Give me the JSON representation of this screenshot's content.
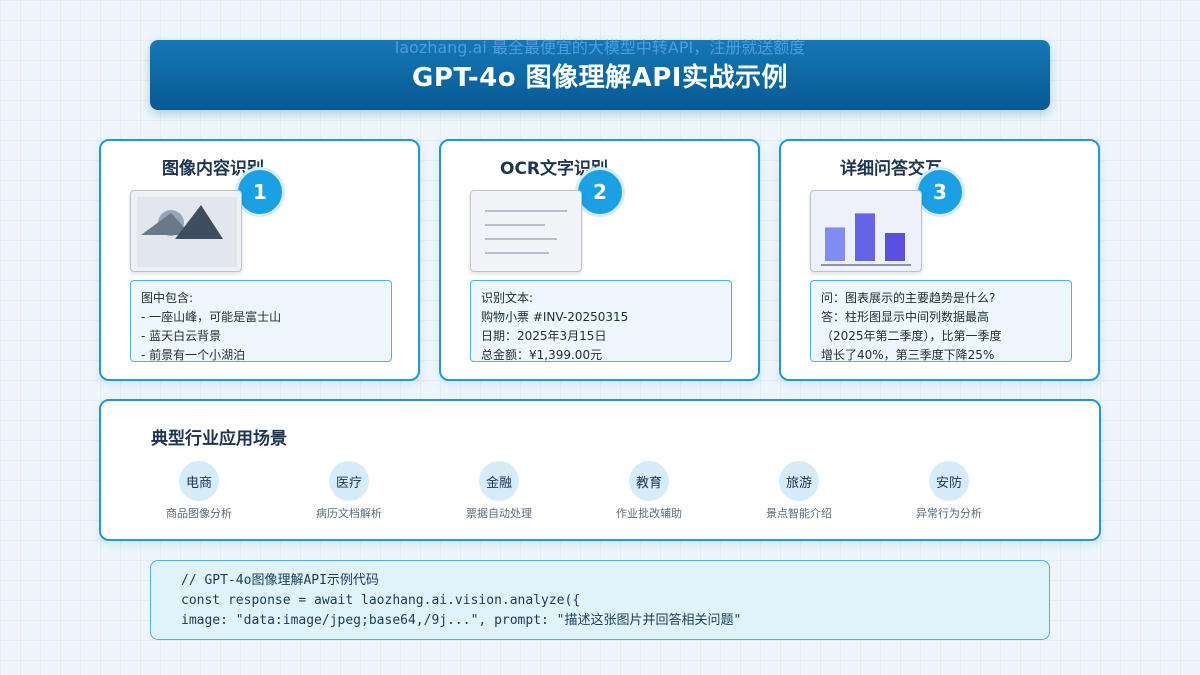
{
  "watermark": "laozhang.ai 最全最便宜的大模型中转API，注册就送额度",
  "title": "GPT-4o 图像理解API实战示例",
  "cards": [
    {
      "title": "图像内容识别",
      "number": "1",
      "lines": [
        "图中包含:",
        "- 一座山峰，可能是富士山",
        "- 蓝天白云背景",
        "- 前景有一个小湖泊"
      ]
    },
    {
      "title": "OCR文字识别",
      "number": "2",
      "lines": [
        "识别文本:",
        "购物小票 #INV-20250315",
        "日期：2025年3月15日",
        "总金额：¥1,399.00元"
      ]
    },
    {
      "title": "详细问答交互",
      "number": "3",
      "lines": [
        "问：图表展示的主要趋势是什么?",
        "答：柱形图显示中间列数据最高",
        "（2025年第二季度），比第一季度",
        "增长了40%，第三季度下降25%"
      ]
    }
  ],
  "industries": {
    "title": "典型行业应用场景",
    "items": [
      {
        "name": "电商",
        "desc": "商品图像分析"
      },
      {
        "name": "医疗",
        "desc": "病历文档解析"
      },
      {
        "name": "金融",
        "desc": "票据自动处理"
      },
      {
        "name": "教育",
        "desc": "作业批改辅助"
      },
      {
        "name": "旅游",
        "desc": "景点智能介绍"
      },
      {
        "name": "安防",
        "desc": "异常行为分析"
      }
    ]
  },
  "code": {
    "lines": [
      "// GPT-4o图像理解API示例代码",
      "const response = await laozhang.ai.vision.analyze({",
      "image: \"data:image/jpeg;base64,/9j...\", prompt: \"描述这张图片并回答相关问题\""
    ]
  },
  "colors": {
    "accent": "#1aa0e4",
    "border": "#1d9ad6",
    "title_bar": "#075a92",
    "bar_chart": [
      "#7f8cf0",
      "#6663e6",
      "#5a4fe0"
    ]
  },
  "thumbnail_chart": {
    "type": "bar",
    "values": [
      0.6,
      0.85,
      0.5
    ]
  },
  "icons": [
    "mountain-image-icon",
    "document-icon",
    "bar-chart-icon"
  ]
}
